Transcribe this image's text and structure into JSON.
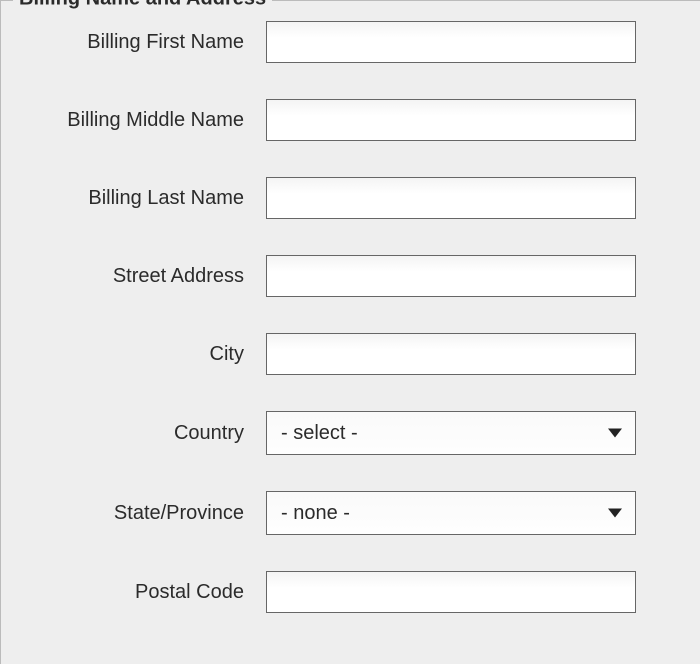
{
  "section": {
    "title": "Billing Name and Address"
  },
  "fields": {
    "first_name": {
      "label": "Billing First Name",
      "value": ""
    },
    "middle_name": {
      "label": "Billing Middle Name",
      "value": ""
    },
    "last_name": {
      "label": "Billing Last Name",
      "value": ""
    },
    "street": {
      "label": "Street Address",
      "value": ""
    },
    "city": {
      "label": "City",
      "value": ""
    },
    "country": {
      "label": "Country",
      "selected": "- select -"
    },
    "state": {
      "label": "State/Province",
      "selected": "- none -"
    },
    "postal": {
      "label": "Postal Code",
      "value": ""
    }
  }
}
